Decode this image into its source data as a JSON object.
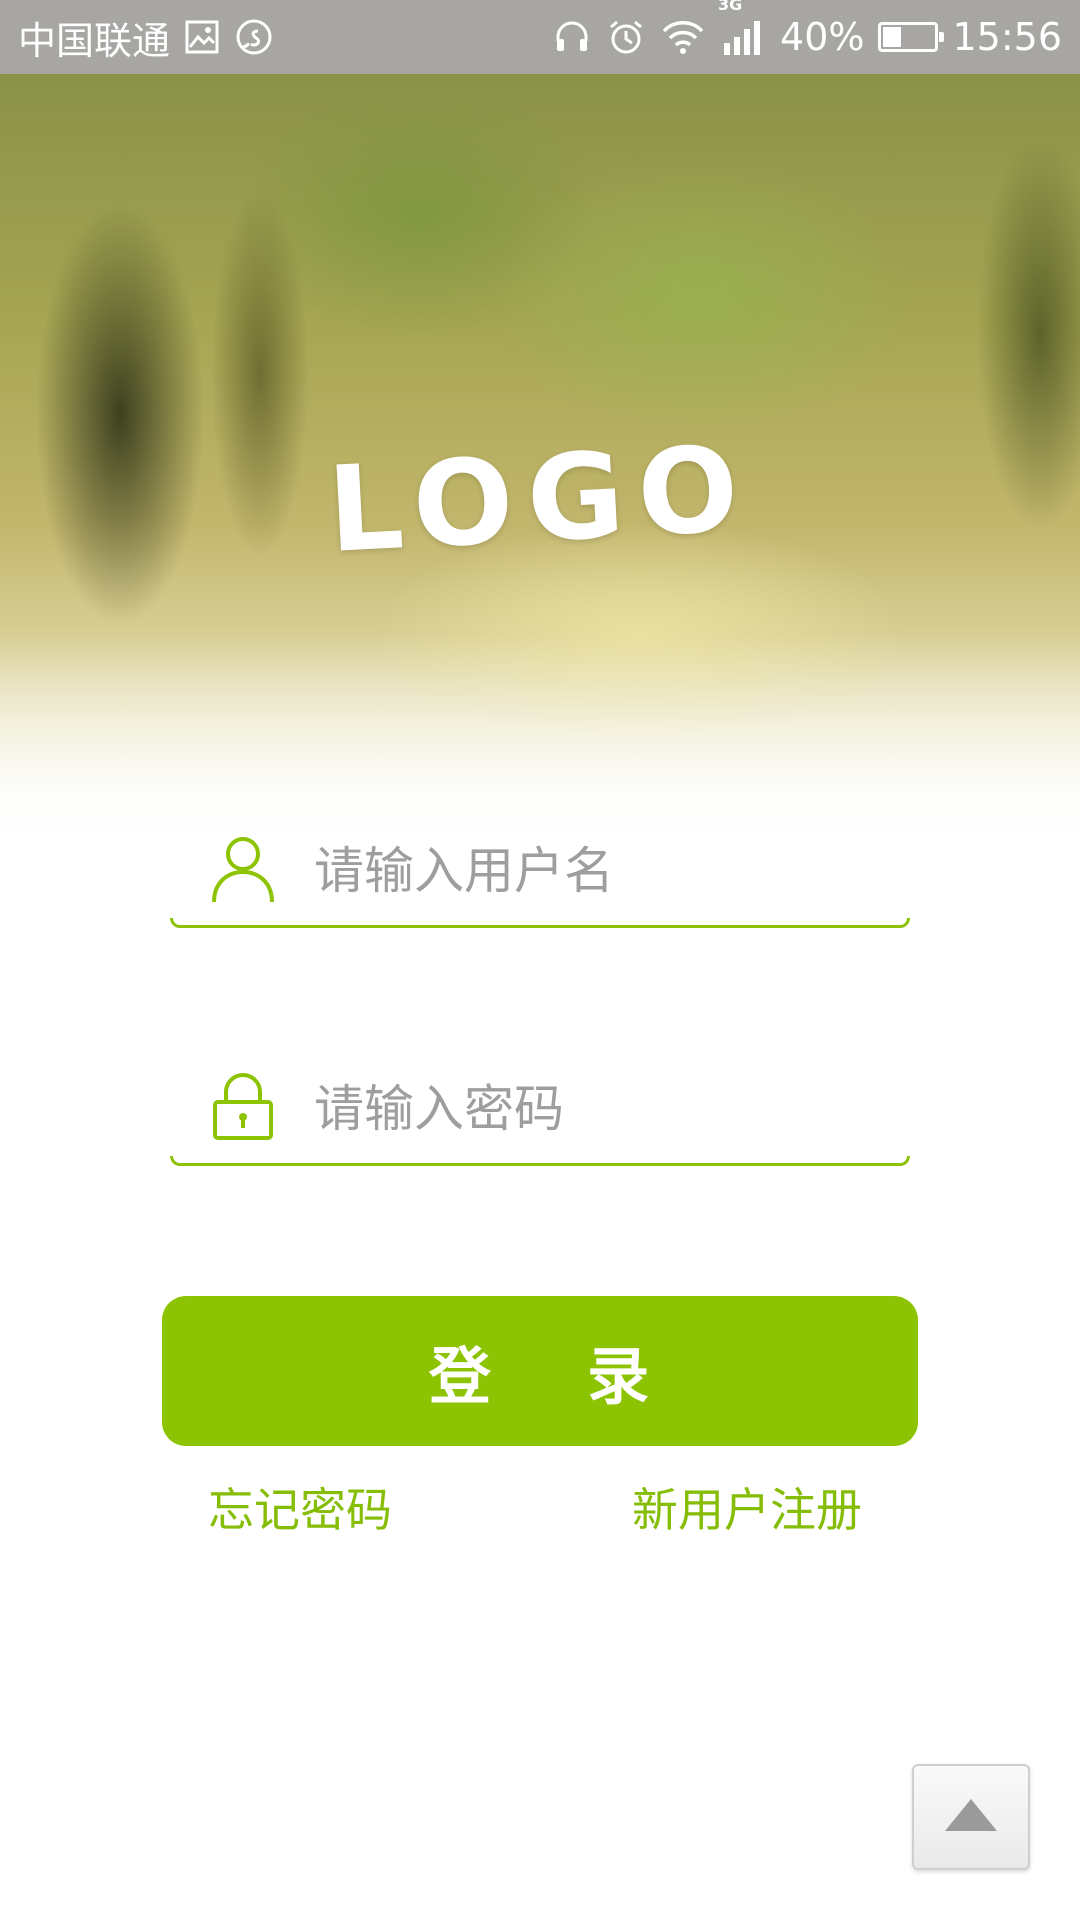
{
  "status_bar": {
    "carrier": "中国联通",
    "network_badge": "3G",
    "battery_percent": "40%",
    "battery_level": 0.4,
    "time": "15:56",
    "icons": [
      "gallery-icon",
      "music-service-icon",
      "headphones-icon",
      "alarm-icon",
      "wifi-icon",
      "signal-icon",
      "battery-icon"
    ]
  },
  "hero": {
    "logo_text": "LOGO"
  },
  "login_form": {
    "username_placeholder": "请输入用户名",
    "password_placeholder": "请输入密码",
    "submit_label": "登    录",
    "forgot_password": "忘记密码",
    "register": "新用户注册"
  },
  "theme": {
    "accent": "#8cc302",
    "link": "#86bd07",
    "placeholder": "#9e9e9e",
    "status_bar_bg": "#a8a6a3"
  }
}
